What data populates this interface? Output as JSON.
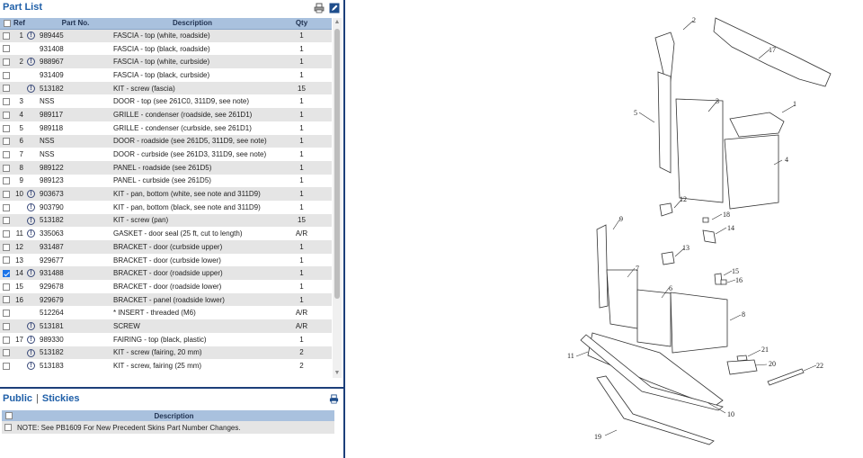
{
  "part_list": {
    "title": "Part List",
    "columns": [
      "Ref",
      "Part No.",
      "Description",
      "Qty"
    ],
    "rows": [
      {
        "ref": "1",
        "info": true,
        "part_no": "989445",
        "description": "FASCIA - top (white, roadside)",
        "qty": "1",
        "checked": false
      },
      {
        "ref": "",
        "info": false,
        "part_no": "931408",
        "description": "FASCIA - top (black, roadside)",
        "qty": "1",
        "checked": false
      },
      {
        "ref": "2",
        "info": true,
        "part_no": "988967",
        "description": "FASCIA - top (white, curbside)",
        "qty": "1",
        "checked": false
      },
      {
        "ref": "",
        "info": false,
        "part_no": "931409",
        "description": "FASCIA - top (black, curbside)",
        "qty": "1",
        "checked": false
      },
      {
        "ref": "",
        "info": true,
        "part_no": "513182",
        "description": "KIT - screw (fascia)",
        "qty": "15",
        "checked": false
      },
      {
        "ref": "3",
        "info": false,
        "part_no": "NSS",
        "description": "DOOR - top (see 261C0, 311D9, see note)",
        "qty": "1",
        "checked": false
      },
      {
        "ref": "4",
        "info": false,
        "part_no": "989117",
        "description": "GRILLE - condenser (roadside, see 261D1)",
        "qty": "1",
        "checked": false
      },
      {
        "ref": "5",
        "info": false,
        "part_no": "989118",
        "description": "GRILLE - condenser (curbside, see 261D1)",
        "qty": "1",
        "checked": false
      },
      {
        "ref": "6",
        "info": false,
        "part_no": "NSS",
        "description": "DOOR - roadside (see 261D5, 311D9, see note)",
        "qty": "1",
        "checked": false
      },
      {
        "ref": "7",
        "info": false,
        "part_no": "NSS",
        "description": "DOOR - curbside (see 261D3, 311D9, see note)",
        "qty": "1",
        "checked": false
      },
      {
        "ref": "8",
        "info": false,
        "part_no": "989122",
        "description": "PANEL - roadside (see 261D5)",
        "qty": "1",
        "checked": false
      },
      {
        "ref": "9",
        "info": false,
        "part_no": "989123",
        "description": "PANEL - curbside (see 261D5)",
        "qty": "1",
        "checked": false
      },
      {
        "ref": "10",
        "info": true,
        "part_no": "903673",
        "description": "KIT - pan, bottom (white, see note and 311D9)",
        "qty": "1",
        "checked": false
      },
      {
        "ref": "",
        "info": true,
        "part_no": "903790",
        "description": "KIT - pan, bottom (black, see note and 311D9)",
        "qty": "1",
        "checked": false
      },
      {
        "ref": "",
        "info": true,
        "part_no": "513182",
        "description": "KIT - screw (pan)",
        "qty": "15",
        "checked": false
      },
      {
        "ref": "11",
        "info": true,
        "part_no": "335063",
        "description": "GASKET - door seal (25 ft, cut to length)",
        "qty": "A/R",
        "checked": false
      },
      {
        "ref": "12",
        "info": false,
        "part_no": "931487",
        "description": "BRACKET - door (curbside upper)",
        "qty": "1",
        "checked": false
      },
      {
        "ref": "13",
        "info": false,
        "part_no": "929677",
        "description": "BRACKET - door (curbside lower)",
        "qty": "1",
        "checked": false
      },
      {
        "ref": "14",
        "info": true,
        "part_no": "931488",
        "description": "BRACKET - door (roadside upper)",
        "qty": "1",
        "checked": true
      },
      {
        "ref": "15",
        "info": false,
        "part_no": "929678",
        "description": "BRACKET - door (roadside lower)",
        "qty": "1",
        "checked": false
      },
      {
        "ref": "16",
        "info": false,
        "part_no": "929679",
        "description": "BRACKET - panel (roadside lower)",
        "qty": "1",
        "checked": false
      },
      {
        "ref": "",
        "info": false,
        "part_no": "512264",
        "description": "* INSERT - threaded (M6)",
        "qty": "A/R",
        "checked": false
      },
      {
        "ref": "",
        "info": true,
        "part_no": "513181",
        "description": "SCREW",
        "qty": "A/R",
        "checked": false
      },
      {
        "ref": "17",
        "info": true,
        "part_no": "989330",
        "description": "FAIRING - top (black, plastic)",
        "qty": "1",
        "checked": false
      },
      {
        "ref": "",
        "info": true,
        "part_no": "513182",
        "description": "KIT - screw (fairing, 20 mm)",
        "qty": "2",
        "checked": false
      },
      {
        "ref": "",
        "info": true,
        "part_no": "513183",
        "description": "KIT - screw, fairing (25 mm)",
        "qty": "2",
        "checked": false
      }
    ]
  },
  "notes": {
    "tabs": [
      "Public",
      "Stickies"
    ],
    "separator": "|",
    "column": "Description",
    "rows": [
      {
        "text": "NOTE: See PB1609 For New Precedent Skins Part Number Changes."
      }
    ]
  },
  "diagram": {
    "callouts": [
      "1",
      "2",
      "3",
      "4",
      "5",
      "6",
      "7",
      "8",
      "9",
      "10",
      "11",
      "12",
      "13",
      "14",
      "15",
      "16",
      "17",
      "18",
      "19",
      "20",
      "21",
      "22"
    ]
  },
  "colors": {
    "header_bg": "#a9c1de",
    "title_blue": "#1f5fa8",
    "divider": "#1c3f7a",
    "row_alt": "#e5e5e5"
  },
  "icons": [
    "print-icon",
    "edit-icon",
    "info-icon",
    "checkbox-checked-icon"
  ]
}
